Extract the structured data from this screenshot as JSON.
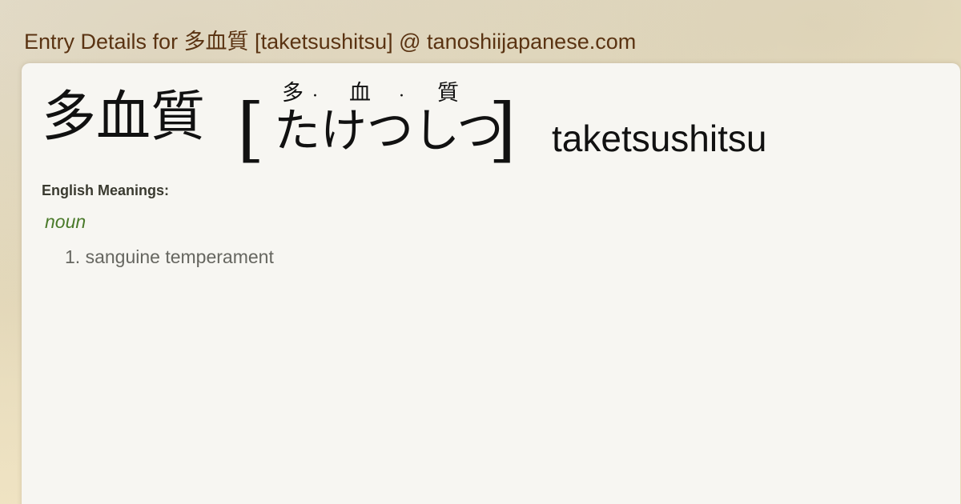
{
  "site": {
    "title": "Entry Details for 多血質 [taketsushitsu] @ tanoshiijapanese.com"
  },
  "entry": {
    "headword": "多血質",
    "bracket_open": "[",
    "bracket_close": "]",
    "furigana": [
      "多",
      "血",
      "質"
    ],
    "furigana_separator": "·",
    "kana": "たけつしつ",
    "romaji": "taketsushitsu"
  },
  "meanings": {
    "heading": "English Meanings:",
    "part_of_speech": "noun",
    "items": [
      "1. sanguine temperament"
    ]
  }
}
